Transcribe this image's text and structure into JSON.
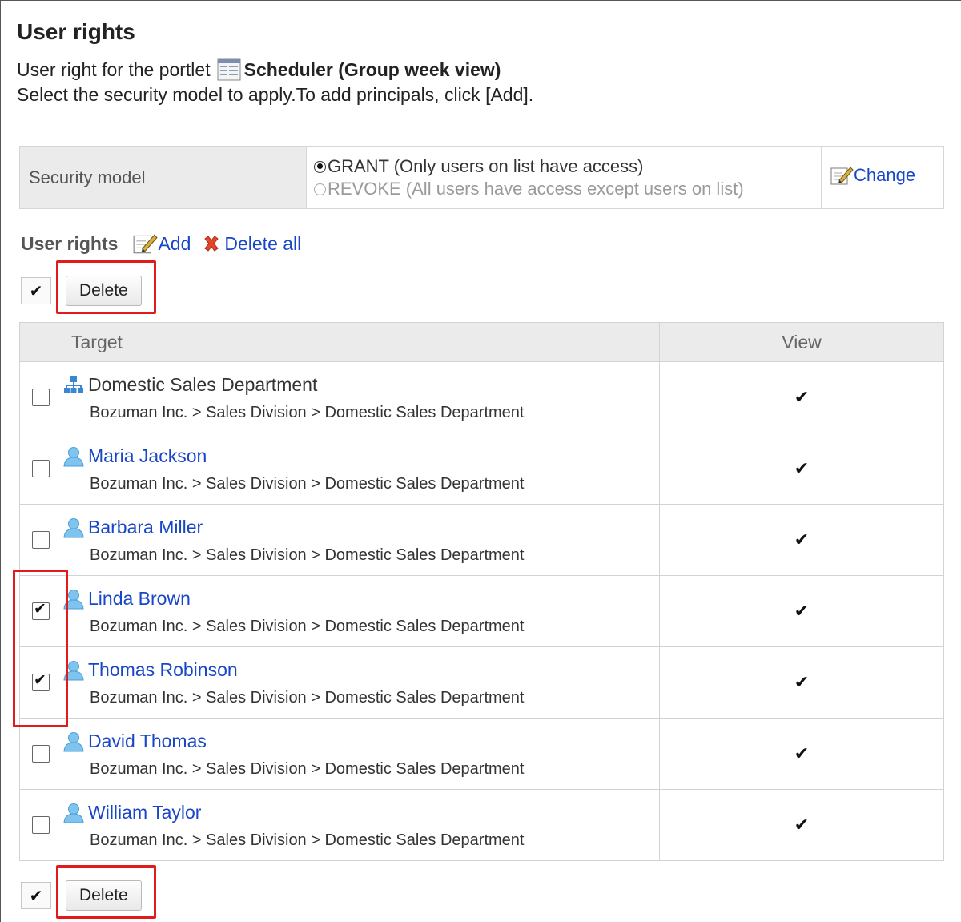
{
  "header": {
    "title": "User rights",
    "portlet_prefix": "User right for the portlet",
    "portlet_name": "Scheduler (Group week view)",
    "instructions": "Select the security model to apply.To add principals, click [Add]."
  },
  "security": {
    "label": "Security model",
    "options": [
      {
        "label": "GRANT (Only users on list have access)",
        "selected": true
      },
      {
        "label": "REVOKE (All users have access except users on list)",
        "selected": false
      }
    ],
    "change_label": "Change"
  },
  "rights": {
    "heading": "User rights",
    "add_label": "Add",
    "delete_all_label": "Delete all"
  },
  "toolbar_top": {
    "check_all": "✔",
    "delete_label": "Delete"
  },
  "toolbar_bottom": {
    "check_all": "✔",
    "delete_label": "Delete"
  },
  "table": {
    "columns": [
      "Target",
      "View"
    ],
    "rows": [
      {
        "name": "Domestic Sales Department",
        "type": "org",
        "path": "Bozuman Inc. > Sales Division > Domestic Sales Department",
        "checked": false,
        "view": "✔"
      },
      {
        "name": "Maria Jackson",
        "type": "user",
        "path": "Bozuman Inc. > Sales Division > Domestic Sales Department",
        "checked": false,
        "view": "✔"
      },
      {
        "name": "Barbara Miller",
        "type": "user",
        "path": "Bozuman Inc. > Sales Division > Domestic Sales Department",
        "checked": false,
        "view": "✔"
      },
      {
        "name": "Linda Brown",
        "type": "user",
        "path": "Bozuman Inc. > Sales Division > Domestic Sales Department",
        "checked": true,
        "view": "✔"
      },
      {
        "name": "Thomas Robinson",
        "type": "user",
        "path": "Bozuman Inc. > Sales Division > Domestic Sales Department",
        "checked": true,
        "view": "✔"
      },
      {
        "name": "David Thomas",
        "type": "user",
        "path": "Bozuman Inc. > Sales Division > Domestic Sales Department",
        "checked": false,
        "view": "✔"
      },
      {
        "name": "William Taylor",
        "type": "user",
        "path": "Bozuman Inc. > Sales Division > Domestic Sales Department",
        "checked": false,
        "view": "✔"
      }
    ]
  },
  "colors": {
    "link": "#1846c8",
    "highlight": "#e11b1b",
    "header_bg": "#ebebeb"
  }
}
